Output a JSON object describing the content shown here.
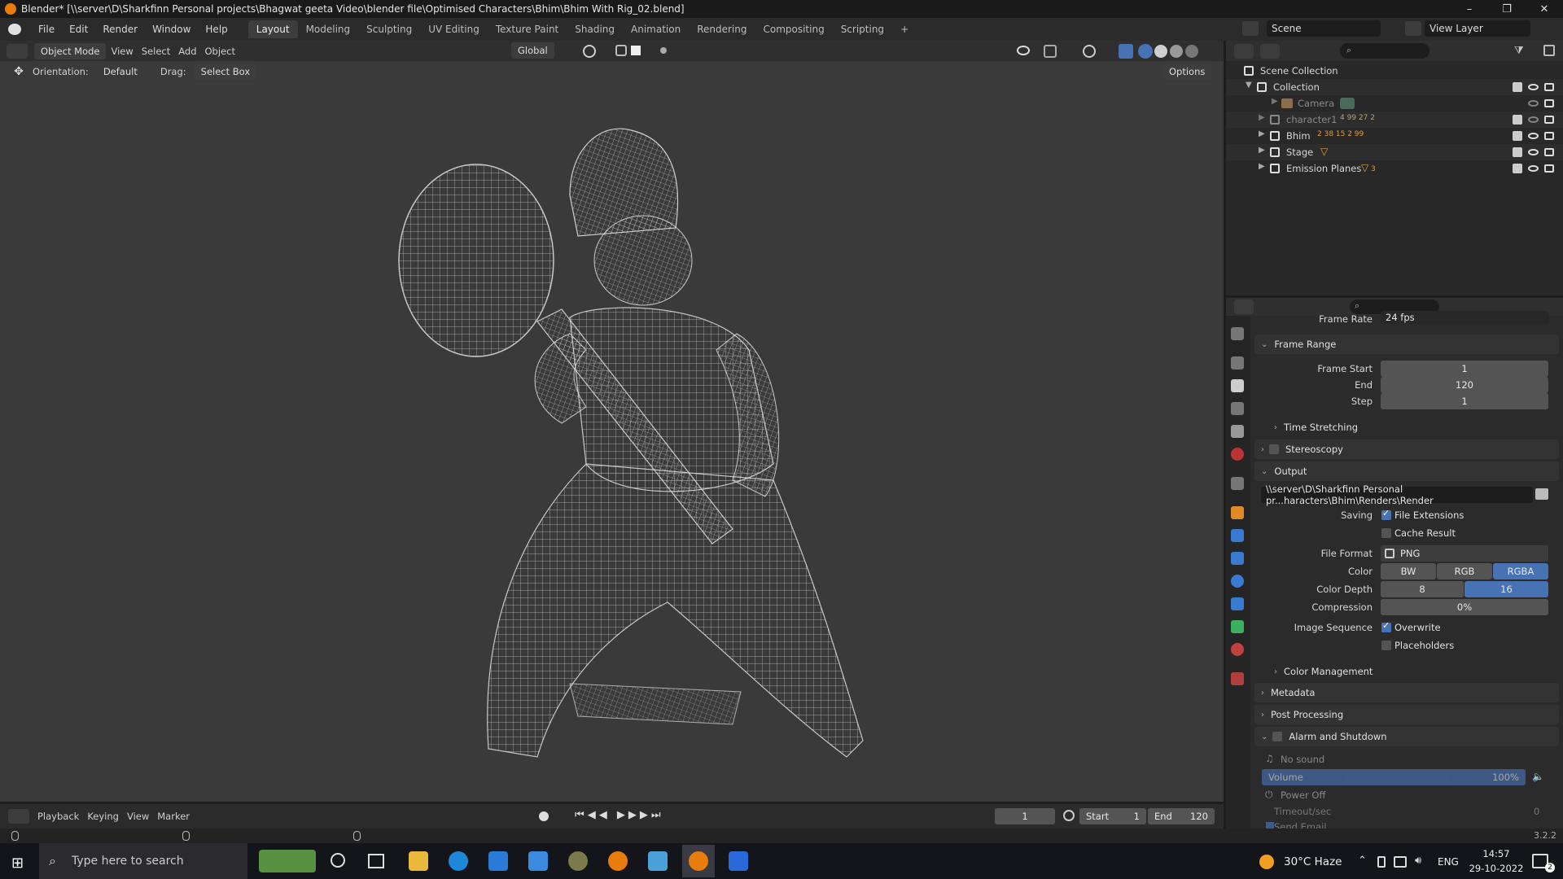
{
  "window": {
    "title": "Blender* [\\\\server\\D\\Sharkfinn Personal projects\\Bhagwat geeta Video\\blender file\\Optimised Characters\\Bhim\\Bhim With Rig_02.blend]",
    "minimize": "–",
    "maximize": "❐",
    "close": "✕"
  },
  "menu": [
    "File",
    "Edit",
    "Render",
    "Window",
    "Help"
  ],
  "workspaces": [
    "Layout",
    "Modeling",
    "Sculpting",
    "UV Editing",
    "Texture Paint",
    "Shading",
    "Animation",
    "Rendering",
    "Compositing",
    "Scripting",
    "+"
  ],
  "active_workspace": "Layout",
  "scene": {
    "label": "Scene",
    "view_layer": "View Layer"
  },
  "viewport_header": {
    "mode": "Object Mode",
    "menus": [
      "View",
      "Select",
      "Add",
      "Object"
    ],
    "transform": "Global"
  },
  "tool_header": {
    "orientation_label": "Orientation:",
    "orientation_value": "Default",
    "drag_label": "Drag:",
    "drag_value": "Select Box",
    "options": "Options"
  },
  "outliner": {
    "root": "Scene Collection",
    "items": [
      {
        "name": "Collection",
        "badge": ""
      },
      {
        "name": "Camera",
        "badge": ""
      },
      {
        "name": "character1",
        "badge": "4  99  27  2"
      },
      {
        "name": "Bhim",
        "badge": "2  38  15  2  99"
      },
      {
        "name": "Stage",
        "badge": ""
      },
      {
        "name": "Emission Planes",
        "badge": "3"
      }
    ]
  },
  "properties": {
    "frame_rate_label": "Frame Rate",
    "frame_rate_value": "24 fps",
    "frame_range": {
      "title": "Frame Range",
      "start_label": "Frame Start",
      "start": "1",
      "end_label": "End",
      "end": "120",
      "step_label": "Step",
      "step": "1"
    },
    "time_stretching": "Time Stretching",
    "stereoscopy": "Stereoscopy",
    "output": {
      "title": "Output",
      "path": "\\\\server\\D\\Sharkfinn Personal pr...haracters\\Bhim\\Renders\\Render",
      "saving_label": "Saving",
      "file_extensions": "File Extensions",
      "cache_result": "Cache Result",
      "file_format_label": "File Format",
      "file_format": "PNG",
      "color_label": "Color",
      "color_options": [
        "BW",
        "RGB",
        "RGBA"
      ],
      "color_selected": "RGBA",
      "color_depth_label": "Color Depth",
      "color_depth_options": [
        "8",
        "16"
      ],
      "color_depth_selected": "16",
      "compression_label": "Compression",
      "compression": "0%",
      "image_sequence_label": "Image Sequence",
      "overwrite": "Overwrite",
      "placeholders": "Placeholders"
    },
    "color_management": "Color Management",
    "metadata": "Metadata",
    "post_processing": "Post Processing",
    "alarm": {
      "title": "Alarm and Shutdown",
      "no_sound": "No sound",
      "volume_label": "Volume",
      "volume": "100%",
      "power_off": "Power Off",
      "timeout_label": "Timeout/sec",
      "timeout": "0",
      "send_email": "Send Email"
    }
  },
  "timeline": {
    "menus": [
      "Playback",
      "Keying",
      "View",
      "Marker"
    ],
    "current_frame": "1",
    "start_label": "Start",
    "start": "1",
    "end_label": "End",
    "end": "120"
  },
  "status": {
    "version": "3.2.2"
  },
  "taskbar": {
    "search_placeholder": "Type here to search",
    "weather": "30°C  Haze",
    "lang": "ENG",
    "time": "14:57",
    "date": "29-10-2022",
    "notifications": "2"
  }
}
